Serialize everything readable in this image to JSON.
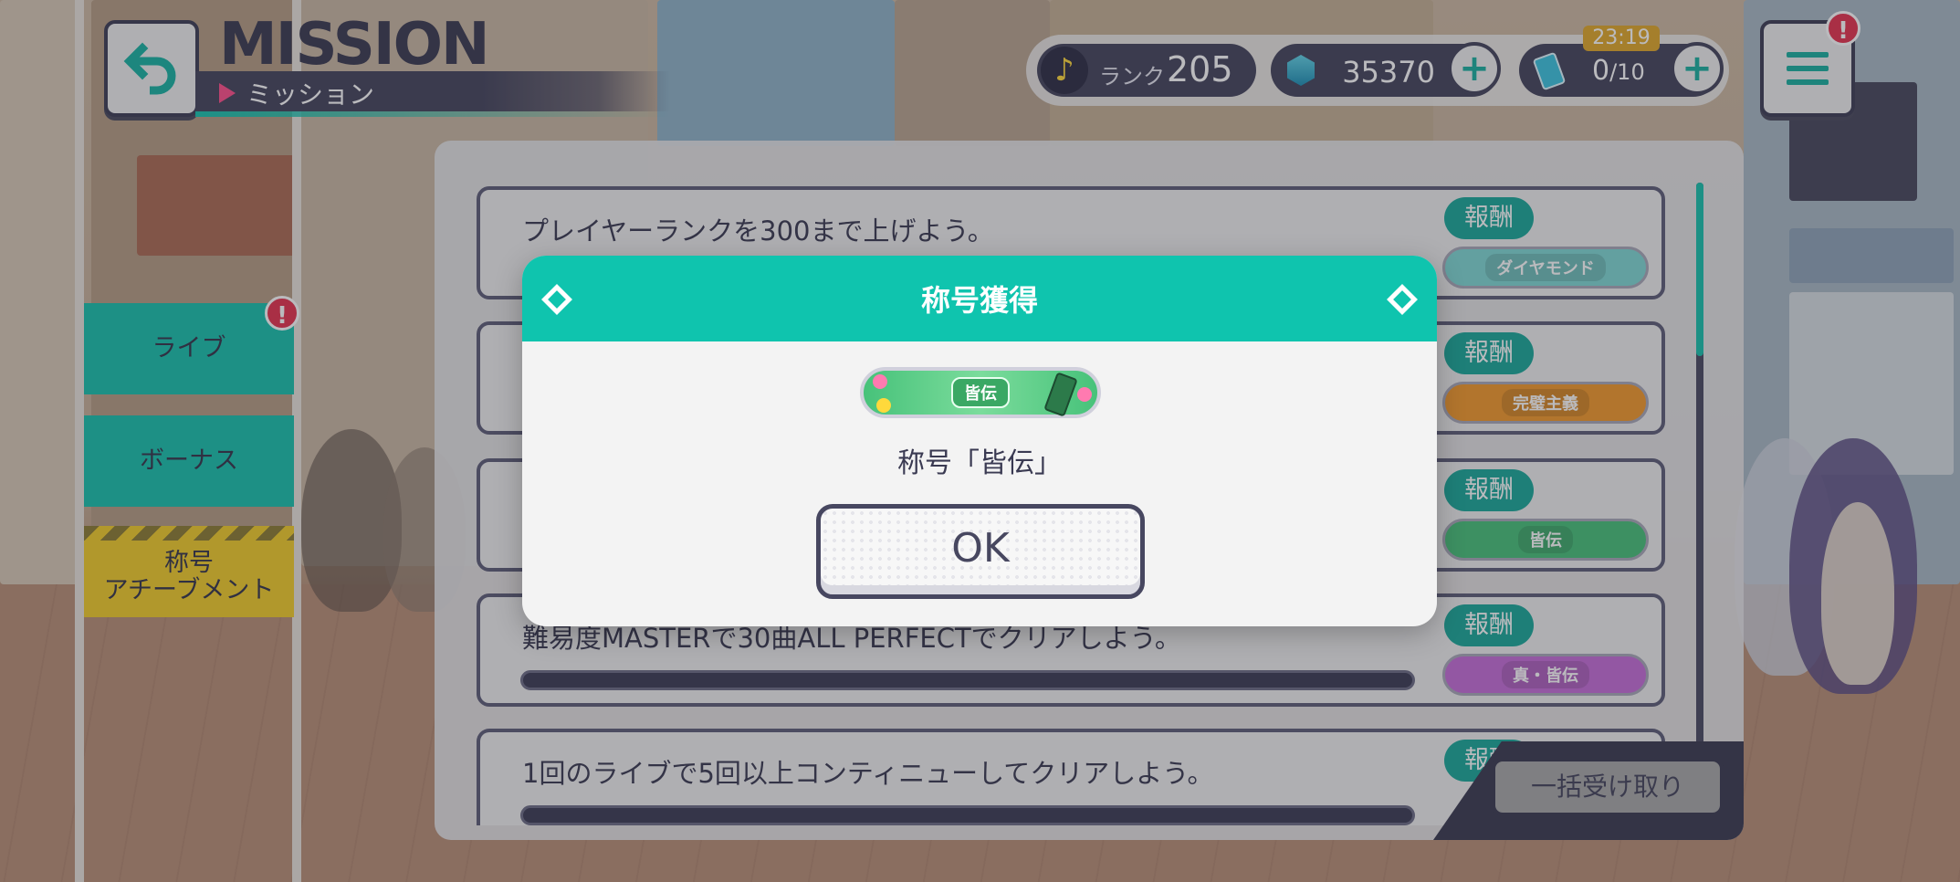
{
  "header": {
    "title_en": "MISSION",
    "title_jp": "ミッション",
    "rank_label": "ランク",
    "rank_value": "205",
    "gems": "35370",
    "energy_current": "0",
    "energy_max": "/10",
    "timer": "23:19",
    "plus": "+",
    "alert_mark": "!"
  },
  "tabs": [
    {
      "label": "ライブ",
      "has_alert": true
    },
    {
      "label": "ボーナス"
    },
    {
      "label_line1": "称号",
      "label_line2": "アチーブメント"
    }
  ],
  "missions": [
    {
      "text": "プレイヤーランクを300まで上げよう。",
      "reward_label": "報酬",
      "plate": "ダイヤモンド",
      "plate_color": "#7fd9d4"
    },
    {
      "text": "",
      "reward_label": "報酬",
      "plate": "完璧主義",
      "plate_color": "#f39a2b"
    },
    {
      "text": "",
      "reward_label": "報酬",
      "plate": "皆伝",
      "plate_color": "#47c27a"
    },
    {
      "text": "難易度MASTERで30曲ALL PERFECTでクリアしよう。",
      "reward_label": "報酬",
      "plate": "真・皆伝",
      "plate_color": "#c66ed9"
    },
    {
      "text": "1回のライブで5回以上コンティニューしてクリアしよう。",
      "reward_label": "報酬",
      "plate": "",
      "plate_color": "#e0e0e0"
    }
  ],
  "claim_all": "一括受け取り",
  "modal": {
    "title": "称号獲得",
    "plate_name": "皆伝",
    "message": "称号「皆伝」",
    "ok": "OK"
  },
  "colors": {
    "teal": "#0fc4ae",
    "navy": "#44445c",
    "yellow": "#f2cd2a",
    "alert": "#e6334e"
  }
}
